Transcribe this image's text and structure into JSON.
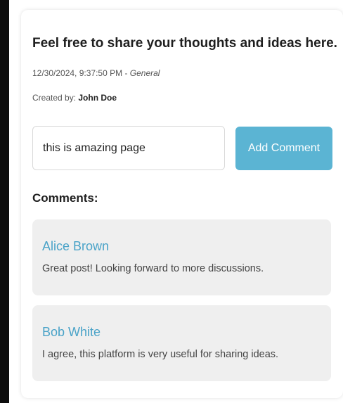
{
  "post": {
    "title": "Feel free to share your thoughts and ideas here.",
    "timestamp": "12/30/2024, 9:37:50 PM",
    "separator": " - ",
    "category": "General",
    "created_by_label": "Created by: ",
    "author": "John Doe"
  },
  "comment_form": {
    "input_value": "this is amazing page",
    "button_label": "Add Comment"
  },
  "comments_section": {
    "heading": "Comments:",
    "items": [
      {
        "author": "Alice Brown",
        "text": "Great post! Looking forward to more discussions."
      },
      {
        "author": "Bob White",
        "text": "I agree, this platform is very useful for sharing ideas."
      }
    ]
  },
  "colors": {
    "accent": "#5bb4d3",
    "author_link": "#4aa3c8",
    "comment_bg": "#efefef",
    "left_bar": "#0d0d0d"
  }
}
